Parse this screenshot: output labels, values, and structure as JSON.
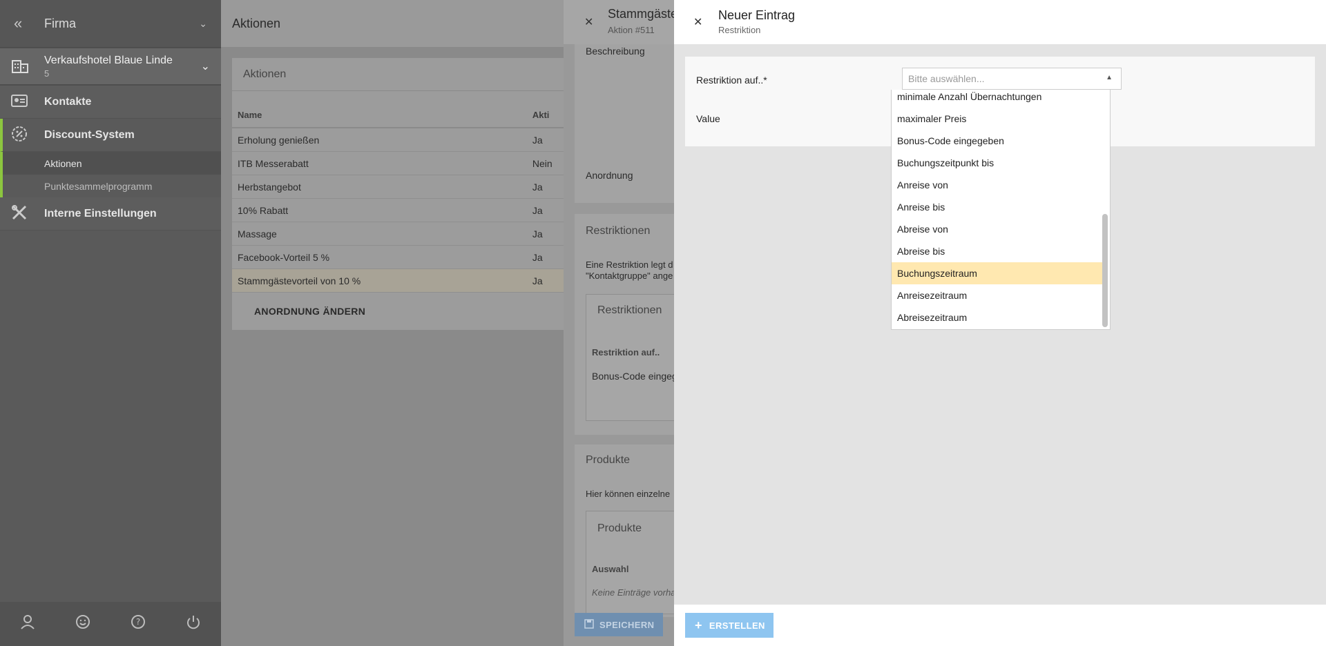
{
  "sidebar": {
    "firm_label": "Firma",
    "hotel": {
      "name": "Verkaufshotel Blaue Linde",
      "sub": "5"
    },
    "items": [
      {
        "label": "Kontakte"
      },
      {
        "label": "Discount-System"
      },
      {
        "label": "Interne Einstellungen"
      }
    ],
    "subitems": [
      {
        "label": "Aktionen"
      },
      {
        "label": "Punktesammelprogramm"
      }
    ],
    "accent_color": "#8cc63f"
  },
  "main": {
    "header_title": "Aktionen",
    "card_title": "Aktionen",
    "columns": [
      "Name",
      "Akti"
    ],
    "rows": [
      {
        "name": "Erholung genießen",
        "akt": "Ja"
      },
      {
        "name": "ITB Messerabatt",
        "akt": "Nein"
      },
      {
        "name": "Herbstangebot",
        "akt": "Ja"
      },
      {
        "name": "10% Rabatt",
        "akt": "Ja"
      },
      {
        "name": "Massage",
        "akt": "Ja"
      },
      {
        "name": "Facebook-Vorteil 5 %",
        "akt": "Ja"
      },
      {
        "name": "Stammgästevorteil von 10 %",
        "akt": "Ja"
      }
    ],
    "reorder_label": "ANORDNUNG ÄNDERN"
  },
  "detail": {
    "title": "Stammgäste",
    "subtitle": "Aktion #511",
    "beschreibung_label": "Beschreibung",
    "anordnung_label": "Anordnung",
    "restriktionen_title": "Restriktionen",
    "restriktionen_text_1": "Eine Restriktion legt d",
    "restriktionen_text_2": "\"Kontaktgruppe\" ange",
    "restr_inner_title": "Restriktionen",
    "restr_col": "Restriktion auf..",
    "restr_value": "Bonus-Code eingege",
    "produkte_title": "Produkte",
    "produkte_text": "Hier können einzelne",
    "prod_inner_title": "Produkte",
    "prod_col": "Auswahl",
    "prod_empty": "Keine Einträge vorhan",
    "save_label": "SPEICHERN"
  },
  "modal": {
    "title": "Neuer Eintrag",
    "subtitle": "Restriktion",
    "field_restriktion_label": "Restriktion auf..*",
    "field_value_label": "Value",
    "select_placeholder": "Bitte auswählen...",
    "options": [
      "minimale Anzahl Übernachtungen",
      "maximaler Preis",
      "Bonus-Code eingegeben",
      "Buchungszeitpunkt bis",
      "Anreise von",
      "Anreise bis",
      "Abreise von",
      "Abreise bis",
      "Buchungszeitraum",
      "Anreisezeitraum",
      "Abreisezeitraum"
    ],
    "highlighted_option": "Buchungszeitraum",
    "create_label": "ERSTELLEN",
    "create_color": "#8ec5f0"
  }
}
